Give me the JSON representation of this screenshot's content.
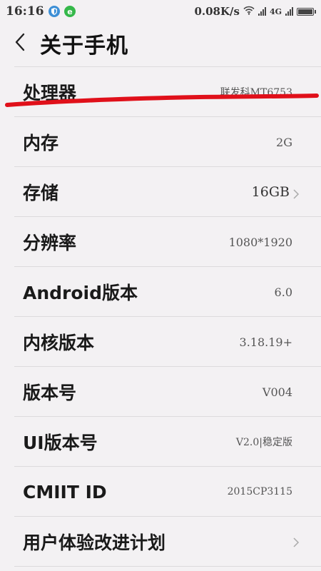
{
  "status_bar": {
    "time": "16:16",
    "speed": "0.08K/s",
    "network": "4G"
  },
  "header": {
    "title": "关于手机"
  },
  "rows": [
    {
      "label": "处理器",
      "value": "联发科MT6753"
    },
    {
      "label": "内存",
      "value": "2G"
    },
    {
      "label": "存储",
      "value": "16GB"
    },
    {
      "label": "分辨率",
      "value": "1080*1920"
    },
    {
      "label": "Android版本",
      "value": "6.0"
    },
    {
      "label": "内核版本",
      "value": "3.18.19+"
    },
    {
      "label": "版本号",
      "value": "V004"
    },
    {
      "label": "UI版本号",
      "value": "V2.0|稳定版"
    },
    {
      "label": "CMIIT ID",
      "value": "2015CP3115"
    },
    {
      "label": "用户体验改进计划",
      "value": ""
    }
  ],
  "colors": {
    "background": "#f3f1f3",
    "annotation_red": "#e0101a",
    "divider": "#dcdadc"
  },
  "icons": {
    "back": "chevron-left-icon",
    "row_chevron": "chevron-right-icon",
    "wifi": "wifi-icon",
    "signal": "signal-icon",
    "battery": "battery-icon"
  }
}
